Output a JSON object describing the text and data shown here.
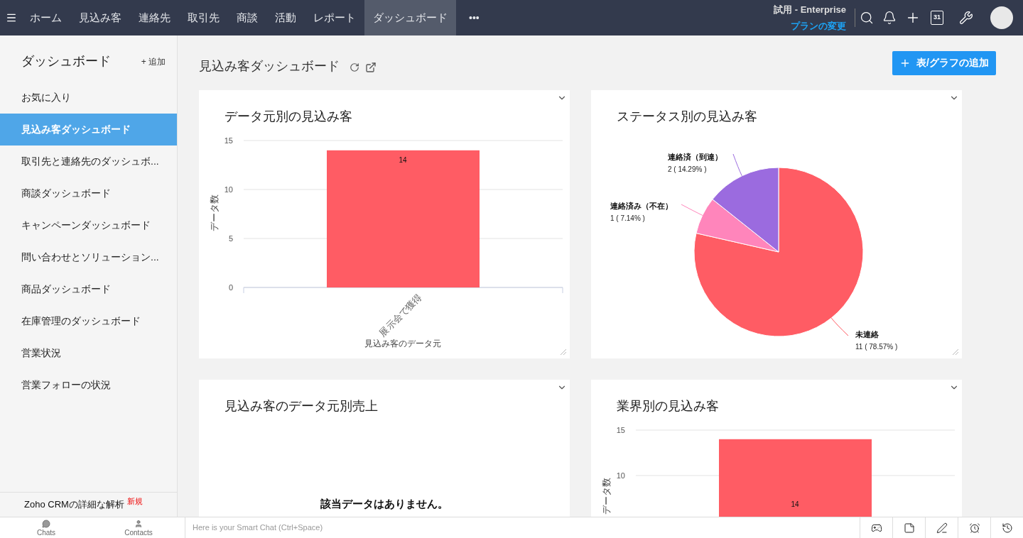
{
  "top_bar": {
    "nav": [
      {
        "label": "ホーム",
        "selected": false
      },
      {
        "label": "見込み客",
        "selected": false
      },
      {
        "label": "連絡先",
        "selected": false
      },
      {
        "label": "取引先",
        "selected": false
      },
      {
        "label": "商談",
        "selected": false
      },
      {
        "label": "活動",
        "selected": false
      },
      {
        "label": "レポート",
        "selected": false
      },
      {
        "label": "ダッシュボード",
        "selected": true
      }
    ],
    "more": "•••",
    "plan": "試用 - Enterprise",
    "change_plan": "プランの変更",
    "calendar_day": "31"
  },
  "sidebar": {
    "title": "ダッシュボード",
    "add": "+ 追加",
    "items": [
      {
        "label": "お気に入り",
        "selected": false
      },
      {
        "label": "見込み客ダッシュボード",
        "selected": true
      },
      {
        "label": "取引先と連絡先のダッシュボ...",
        "selected": false
      },
      {
        "label": "商談ダッシュボード",
        "selected": false
      },
      {
        "label": "キャンペーンダッシュボード",
        "selected": false
      },
      {
        "label": "問い合わせとソリューション...",
        "selected": false
      },
      {
        "label": "商品ダッシュボード",
        "selected": false
      },
      {
        "label": "在庫管理のダッシュボード",
        "selected": false
      },
      {
        "label": "営業状況",
        "selected": false
      },
      {
        "label": "営業フォローの状況",
        "selected": false
      }
    ],
    "footer": {
      "label": "Zoho CRMの詳細な解析",
      "badge": "新規"
    }
  },
  "page": {
    "title": "見込み客ダッシュボード",
    "add_button": "表/グラフの追加"
  },
  "cards": [
    {
      "kind": "chart",
      "title": "データ元別の見込み客",
      "chart_data": {
        "type": "bar",
        "categories": [
          "展示会で獲得"
        ],
        "series": [
          {
            "color": "#ff5c64",
            "values": [
              14
            ]
          }
        ],
        "xlabel": "見込み客のデータ元",
        "ylabel": "データ数",
        "ylim": [
          0,
          15
        ],
        "yticks": [
          0,
          5,
          10,
          15
        ],
        "data_labels": true
      }
    },
    {
      "kind": "chart",
      "title": "ステータス別の見込み客",
      "chart_data": {
        "type": "pie",
        "categories": [
          "未連絡",
          "連絡済み（不在）",
          "連絡済（到達）"
        ],
        "values": [
          11,
          1,
          2
        ],
        "colors": [
          "#ff5c64",
          "#ff85bb",
          "#9b6bdf"
        ],
        "value_labels": [
          "11 ( 78.57% )",
          "1 ( 7.14% )",
          "2 ( 14.29% )"
        ]
      }
    },
    {
      "kind": "empty",
      "title": "見込み客のデータ元別売上",
      "message": "該当データはありません。"
    },
    {
      "kind": "chart",
      "title": "業界別の見込み客",
      "chart_data": {
        "type": "bar",
        "series": [
          {
            "color": "#ff5c64",
            "values": [
              14
            ]
          }
        ],
        "ylabel": "データ数",
        "ylim": [
          0,
          15
        ],
        "yticks": [
          10,
          15
        ],
        "data_labels": true
      }
    }
  ],
  "bottom_bar": {
    "tabs": [
      "Chats",
      "Contacts"
    ],
    "chat_placeholder": "Here is your Smart Chat (Ctrl+Space)"
  }
}
